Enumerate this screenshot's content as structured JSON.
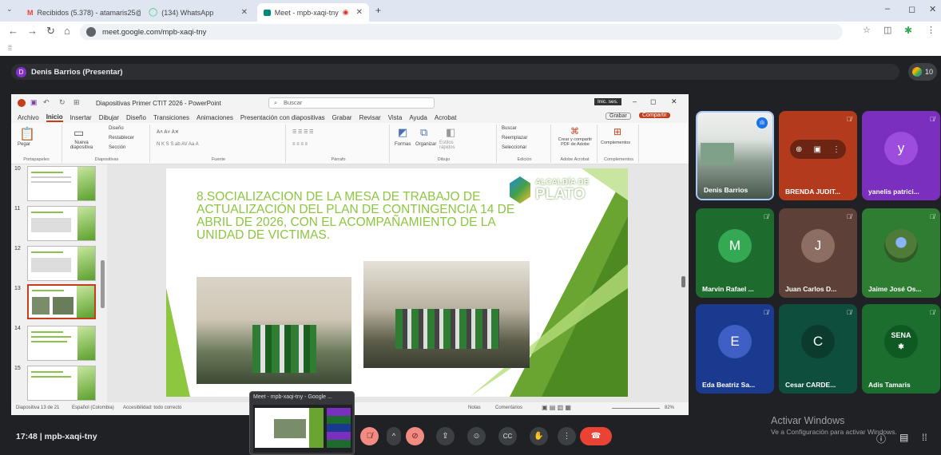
{
  "browser": {
    "tabs": [
      {
        "title": "Recibidos (5.378) - atamaris25@",
        "favicon_color": "#ea4335"
      },
      {
        "title": "(134) WhatsApp",
        "favicon_color": "#25d366"
      },
      {
        "title": "Meet - mpb-xaqi-tny",
        "favicon_color": "#00897b"
      }
    ],
    "url": "meet.google.com/mpb-xaqi-tny",
    "window_controls": {
      "minimize": "–",
      "maximize": "◻",
      "close": "✕"
    }
  },
  "meet": {
    "presenter_label": "Denis Barrios (Presentar)",
    "presenter_initial": "D",
    "participant_count": "10",
    "meeting_code_line": "17:48  |  mpb-xaqi-tny",
    "activate_windows_title": "Activar Windows",
    "activate_windows_sub": "Ve a Configuración para activar Windows.",
    "popup_title": "Meet - mpb-xaqi-tny - Google ..."
  },
  "powerpoint": {
    "title": "Diapositivas Primer CTIT 2026  -  PowerPoint",
    "search_placeholder": "Buscar",
    "sign_in": "Inic. ses.",
    "menu": [
      "Archivo",
      "Inicio",
      "Insertar",
      "Dibujar",
      "Diseño",
      "Transiciones",
      "Animaciones",
      "Presentación con diapositivas",
      "Grabar",
      "Revisar",
      "Vista",
      "Ayuda",
      "Acrobat"
    ],
    "record_button": "Grabar",
    "share_button": "Compartir",
    "ribbon_groups": {
      "clipboard": "Portapapeles",
      "paste": "Pegar",
      "slides": "Diapositivas",
      "new_slide": "Nueva diapositiva",
      "layout": "Diseño",
      "reset": "Restablecer",
      "section": "Sección",
      "font": "Fuente",
      "paragraph": "Párrafo",
      "drawing": "Dibujo",
      "shapes": "Formas",
      "arrange": "Organizar",
      "quick_styles": "Estilos rápidos",
      "editing": "Edición",
      "find": "Buscar",
      "replace": "Reemplazar",
      "select": "Seleccionar",
      "adobe_create": "Crear y compartir PDF de Adobe",
      "adobe": "Adobe Acrobat",
      "addins_label": "Complementos",
      "addins": "Complementos"
    },
    "thumbnails": [
      "10",
      "11",
      "12",
      "13",
      "14",
      "15"
    ],
    "selected_thumbnail": "13",
    "slide": {
      "title": "8.SOCIALIZACION DE LA MESA DE TRABAJO DE ACTUALIZACIÓN DEL PLAN DE CONTINGENCIA 14 DE ABRIL DE 2026, CON EL ACOMPAÑAMIENTO DE LA UNIDAD DE VICTIMAS.",
      "logo_top": "ALCALDÍA DE",
      "logo_main": "PLATO",
      "title_color": "#8dc63f"
    },
    "status": {
      "slide_counter": "Diapositiva 13 de 21",
      "language": "Español (Colombia)",
      "accessibility": "Accesibilidad: todo correcto",
      "notes": "Notas",
      "comments": "Comentarios",
      "zoom": "82%"
    }
  },
  "tiles": [
    {
      "name": "Denis Barrios",
      "kind": "video",
      "muted": false
    },
    {
      "name": "BRENDA JUDIT...",
      "kind": "avatar",
      "initial": "",
      "bg": "#b33a1c",
      "muted": true
    },
    {
      "name": "yanelis patrici...",
      "kind": "avatar",
      "initial": "y",
      "bg": "#7b2fbe",
      "avatar_bg": "#9c4ddb",
      "muted": true
    },
    {
      "name": "Marvin Rafael ...",
      "kind": "avatar",
      "initial": "M",
      "bg": "#1e6b2e",
      "avatar_bg": "#34a853",
      "muted": true
    },
    {
      "name": "Juan Carlos D...",
      "kind": "avatar",
      "initial": "J",
      "bg": "#5d4037",
      "avatar_bg": "#8d6e63",
      "muted": true
    },
    {
      "name": "Jaime José Os...",
      "kind": "photo",
      "bg": "#2e7d32",
      "muted": true
    },
    {
      "name": "Eda Beatriz Sa...",
      "kind": "avatar",
      "initial": "E",
      "bg": "#1a3a8f",
      "avatar_bg": "#3f5fc4",
      "muted": true
    },
    {
      "name": "Cesar CARDE...",
      "kind": "avatar",
      "initial": "C",
      "bg": "#0d4f3c",
      "avatar_bg": "#0b3b2d",
      "muted": true
    },
    {
      "name": "Adis Tamaris",
      "kind": "logo",
      "bg": "#1b6e2e",
      "muted": true
    }
  ],
  "controls": [
    "mic-off",
    "camera-off",
    "present",
    "emoji",
    "captions",
    "raise-hand",
    "more",
    "leave"
  ]
}
